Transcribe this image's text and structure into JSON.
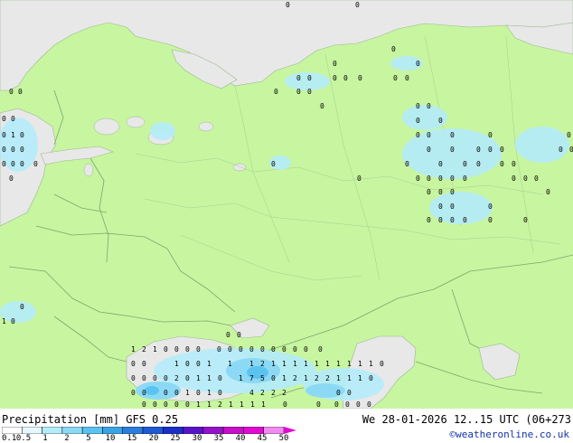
{
  "map": {
    "colors": {
      "land": "#c8f5a0",
      "water": "#e8e8e8",
      "border": "#7aa86a",
      "coast": "#9ab890"
    },
    "cell_values": [
      {
        "lat_lon_row": 1,
        "text": "0"
      },
      {
        "lat_lon_row": 1,
        "text": "1"
      },
      {
        "lat_lon_row": 1,
        "text": "2"
      },
      {
        "lat_lon_row": 1,
        "text": "7"
      },
      {
        "lat_lon_row": 1,
        "text": "5"
      },
      {
        "lat_lon_row": 1,
        "text": "4"
      }
    ]
  },
  "footer": {
    "title_left": "Precipitation [mm]  GFS 0.25",
    "title_right": "We 28-01-2026 12..15 UTC (06+273",
    "copyright": "©weatheronline.co.uk",
    "scale_ticks": [
      "0.1",
      "0.5",
      "1",
      "2",
      "5",
      "10",
      "15",
      "20",
      "25",
      "30",
      "35",
      "40",
      "45",
      "50"
    ],
    "scale_colors": [
      "#ffffff",
      "#e6f8ff",
      "#b4ecfa",
      "#8cd9f5",
      "#5ac3f0",
      "#3aa3e6",
      "#2a7fdc",
      "#1e5ad2",
      "#1a2fc8",
      "#5a14c8",
      "#9612c8",
      "#c810c8",
      "#e00ad2",
      "#f08cf0"
    ]
  }
}
